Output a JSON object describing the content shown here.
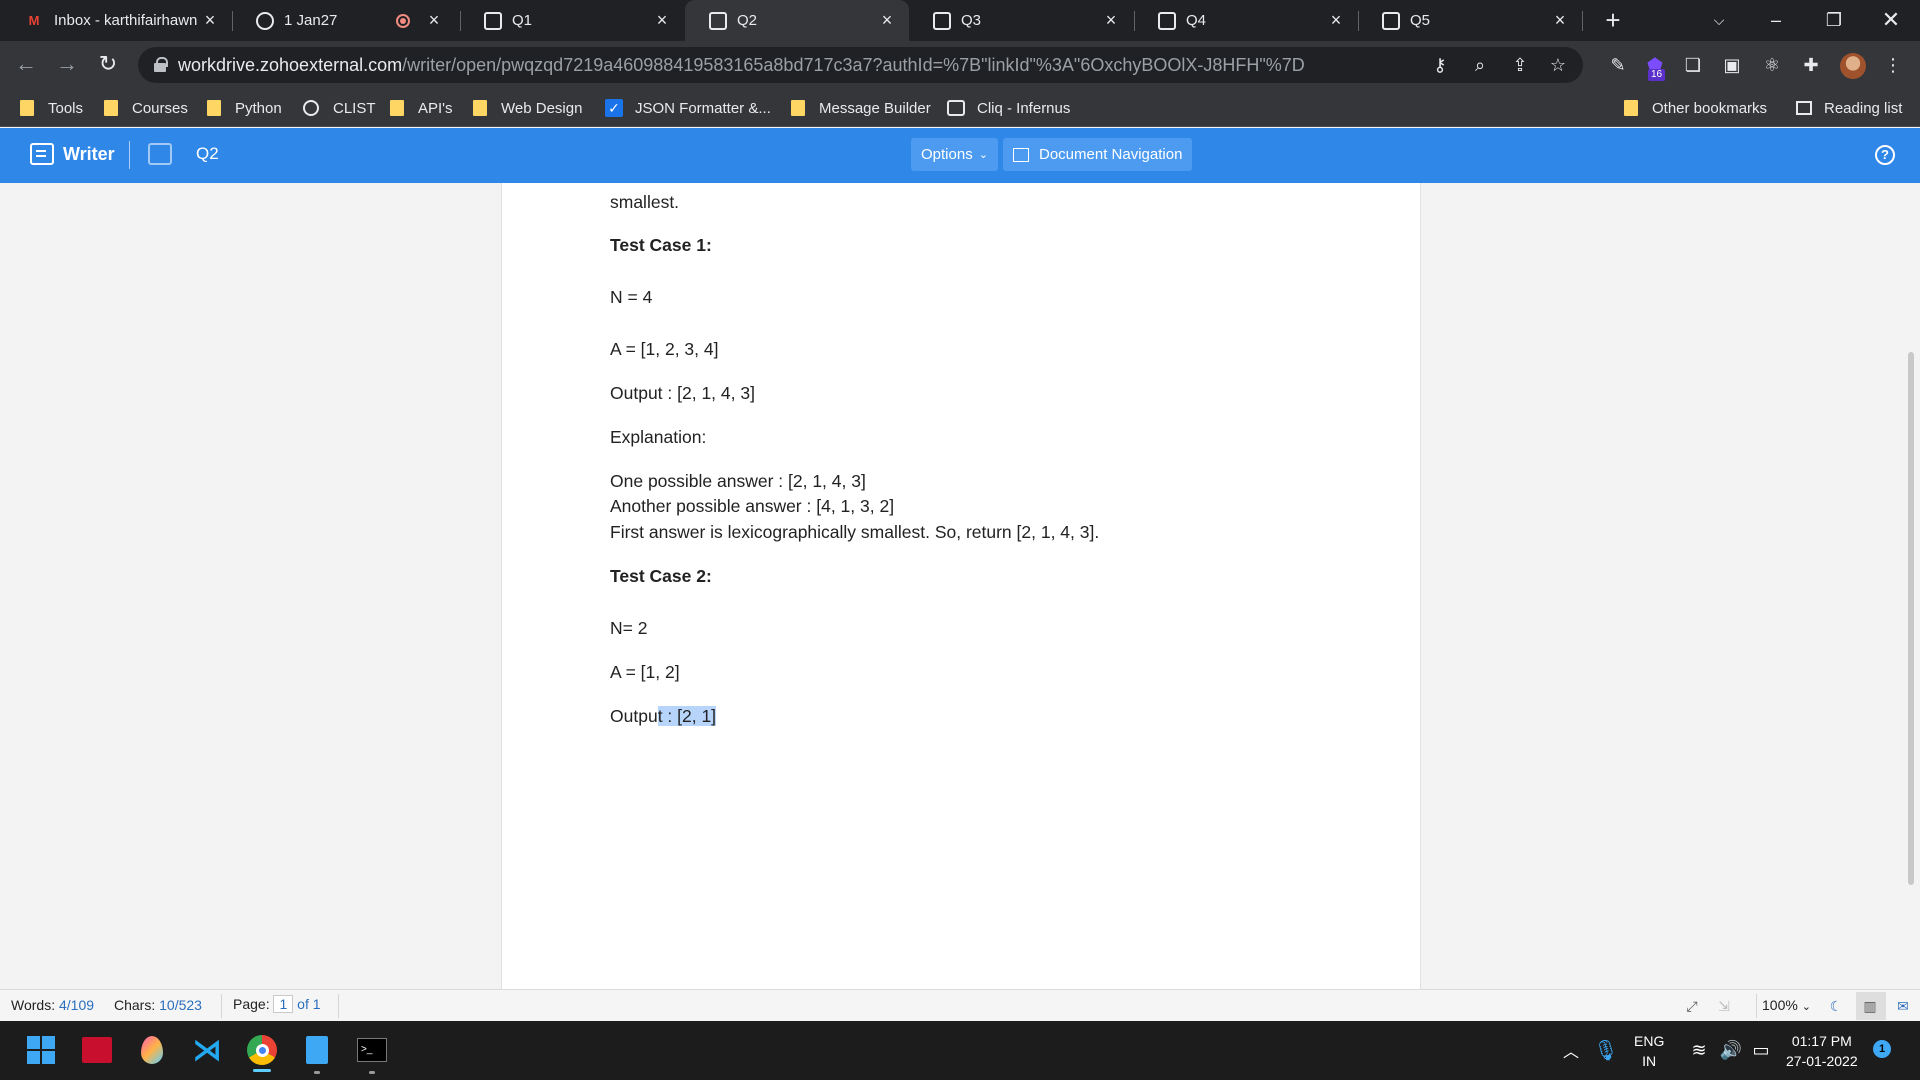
{
  "browser": {
    "tabs": [
      {
        "title": "Inbox - karthifairhawn",
        "favicon": "gmail-icon"
      },
      {
        "title": "1 Jan27",
        "favicon": "chatgpt-icon"
      },
      {
        "title": "Q1",
        "favicon": "zoho-writer-icon"
      },
      {
        "title": "Q2",
        "favicon": "zoho-writer-icon",
        "active": true
      },
      {
        "title": "Q3",
        "favicon": "zoho-writer-icon"
      },
      {
        "title": "Q4",
        "favicon": "zoho-writer-icon"
      },
      {
        "title": "Q5",
        "favicon": "zoho-writer-icon"
      }
    ],
    "url_host": "workdrive.zohoexternal.com",
    "url_path": "/writer/open/pwqzqd7219a460988419583165a8bd717c3a7?authId=%7B\"linkId\"%3A\"6OxchyBOOlX-J8HFH\"%7D",
    "extension_badge": "16",
    "bookmarks": [
      {
        "label": "Tools",
        "icon": "folder-icon"
      },
      {
        "label": "Courses",
        "icon": "folder-icon"
      },
      {
        "label": "Python",
        "icon": "folder-icon"
      },
      {
        "label": "CLIST",
        "icon": "globe-icon"
      },
      {
        "label": "API's",
        "icon": "folder-icon"
      },
      {
        "label": "Web Design",
        "icon": "folder-icon"
      },
      {
        "label": "JSON Formatter &...",
        "icon": "checkbox-icon"
      },
      {
        "label": "Message Builder",
        "icon": "folder-icon"
      },
      {
        "label": "Cliq - Infernus",
        "icon": "cliq-icon"
      }
    ],
    "other_bookmarks": "Other bookmarks",
    "reading_list": "Reading list"
  },
  "writer": {
    "app_name": "Writer",
    "doc_title": "Q2",
    "options_label": "Options",
    "doc_nav_label": "Document Navigation",
    "accent": "#2f87e8"
  },
  "document": {
    "lines": {
      "l0": "smallest.",
      "tc1_heading": "Test Case 1:",
      "tc1_n": "N = 4",
      "tc1_a": "A = [1, 2, 3, 4]",
      "tc1_output": "Output : [2, 1, 4, 3]",
      "explanation": "Explanation:",
      "ans1": "One possible answer : [2, 1, 4, 3]",
      "ans2": "Another possible answer : [4, 1, 3, 2]",
      "ans3": "First answer is lexicographically smallest. So, return [2, 1, 4, 3].",
      "tc2_heading": "Test Case 2:",
      "tc2_n": "N= 2",
      "tc2_a": "A = [1, 2]",
      "tc2_output_plain": "Outpu",
      "tc2_output_selected": "t : [2, 1]"
    }
  },
  "status": {
    "words_label": "Words:",
    "words_value": "4/109",
    "chars_label": "Chars:",
    "chars_value": "10/523",
    "page_label": "Page:",
    "page_current": "1",
    "page_total": "of 1",
    "zoom": "100%"
  },
  "taskbar": {
    "apps": [
      "windows-start-icon",
      "app-red-icon",
      "drop-icon",
      "vscode-icon",
      "chrome-icon",
      "notepad-icon",
      "terminal-icon"
    ],
    "lang_top": "ENG",
    "lang_bottom": "IN",
    "time": "01:17 PM",
    "date": "27-01-2022",
    "notifications": "1"
  }
}
